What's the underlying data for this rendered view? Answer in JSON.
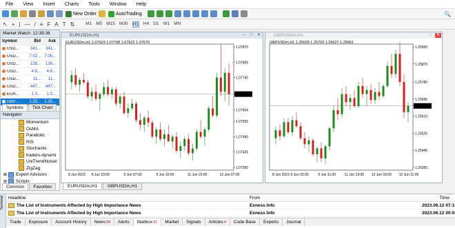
{
  "menu": [
    "File",
    "View",
    "Insert",
    "Charts",
    "Tools",
    "Window",
    "Help"
  ],
  "toolbar": {
    "new_order": "New Order",
    "autotrading": "AutoTrading"
  },
  "timeframes": [
    "M1",
    "M5",
    "M15",
    "M30",
    "H1",
    "H4",
    "D1",
    "W1",
    "MN"
  ],
  "market_watch": {
    "title": "Market Watch: 12:39:36",
    "headers": [
      "Symbol",
      "Bid",
      "Ask"
    ],
    "rows": [
      {
        "symbol": "USD...",
        "bid": "341...",
        "ask": "341...",
        "color": "#e07a2b"
      },
      {
        "symbol": "USD...",
        "bid": "7.02...",
        "ask": "7.05...",
        "color": "#e07a2b"
      },
      {
        "symbol": "USD...",
        "bid": "128...",
        "ask": "128...",
        "color": "#e07a2b"
      },
      {
        "symbol": "USD...",
        "bid": "4.6...",
        "ask": "4.6...",
        "color": "#e07a2b"
      },
      {
        "symbol": "USD...",
        "bid": "11...",
        "ask": "11...",
        "color": "#e07a2b"
      },
      {
        "symbol": "USD...",
        "bid": "447...",
        "ask": "447...",
        "color": "#e07a2b"
      },
      {
        "symbol": "EUR...",
        "bid": "1.0...",
        "ask": "1.0...",
        "color": "#e07a2b"
      },
      {
        "symbol": "GBP...",
        "bid": "1.25...",
        "ask": "1.25...",
        "color": "#ffffff"
      }
    ],
    "tabs": [
      "Symbols",
      "Tick Chart"
    ]
  },
  "navigator": {
    "title": "Navigator",
    "items": [
      "Momentum",
      "OsMA",
      "Parabolic",
      "RSI",
      "Stochastic",
      "traders-dynami",
      "UniTrendNoisel",
      "ZigZag"
    ],
    "groups": [
      "Expert Advisors",
      "Scripts"
    ],
    "tabs": [
      "Common",
      "Favorites"
    ]
  },
  "chart1": {
    "window_title": "EURUSDm,H1",
    "header": "EURUSDm,H1  1.07623 1.07708 1.07622 1.07670",
    "price_labels": [
      "1.07870",
      "1.07805",
      "1.07740",
      "1.07670",
      "1.07604",
      "1.07555",
      "1.07490",
      "1.07425",
      "1.07360"
    ],
    "current_price": "1.07670",
    "time_labels": [
      "8 Jun 2023",
      "8 Jun 23:00",
      "9 Jun 07:00",
      "9 Jun 15:00",
      "11 Jun 23:00",
      "12 Jun 07:00"
    ],
    "candles": [
      [
        1.0772,
        1.0777,
        1.0769,
        1.0775
      ],
      [
        1.0775,
        1.0778,
        1.077,
        1.0771
      ],
      [
        1.0771,
        1.0774,
        1.0768,
        1.0773
      ],
      [
        1.0773,
        1.0776,
        1.0771,
        1.0772
      ],
      [
        1.0772,
        1.0773,
        1.0765,
        1.0766
      ],
      [
        1.0766,
        1.077,
        1.0764,
        1.0768
      ],
      [
        1.0768,
        1.0771,
        1.0764,
        1.0765
      ],
      [
        1.0765,
        1.0768,
        1.076,
        1.0767
      ],
      [
        1.0767,
        1.0772,
        1.0766,
        1.077
      ],
      [
        1.077,
        1.0773,
        1.0766,
        1.0767
      ],
      [
        1.0767,
        1.077,
        1.0765,
        1.0769
      ],
      [
        1.0769,
        1.077,
        1.0762,
        1.0763
      ],
      [
        1.0763,
        1.0767,
        1.0761,
        1.0766
      ],
      [
        1.0766,
        1.0768,
        1.0758,
        1.0759
      ],
      [
        1.0759,
        1.0763,
        1.0757,
        1.0761
      ],
      [
        1.0761,
        1.0765,
        1.076,
        1.0763
      ],
      [
        1.0763,
        1.0764,
        1.0755,
        1.0756
      ],
      [
        1.0756,
        1.0759,
        1.0752,
        1.0754
      ],
      [
        1.0754,
        1.0758,
        1.0751,
        1.0757
      ],
      [
        1.0757,
        1.076,
        1.0753,
        1.0755
      ],
      [
        1.0755,
        1.0756,
        1.0748,
        1.0749
      ],
      [
        1.0749,
        1.0753,
        1.0746,
        1.0752
      ],
      [
        1.0752,
        1.0755,
        1.0747,
        1.0748
      ],
      [
        1.0748,
        1.0752,
        1.0745,
        1.075
      ],
      [
        1.075,
        1.0754,
        1.0747,
        1.0747
      ],
      [
        1.0747,
        1.075,
        1.0744,
        1.0749
      ],
      [
        1.0749,
        1.0751,
        1.0742,
        1.0743
      ],
      [
        1.0743,
        1.0747,
        1.074,
        1.0745
      ],
      [
        1.0745,
        1.0749,
        1.0743,
        1.0748
      ],
      [
        1.0748,
        1.075,
        1.0741,
        1.0742
      ],
      [
        1.0742,
        1.0746,
        1.0739,
        1.0744
      ],
      [
        1.0744,
        1.0752,
        1.0743,
        1.0751
      ],
      [
        1.0751,
        1.0756,
        1.0748,
        1.0749
      ],
      [
        1.0749,
        1.0753,
        1.0745,
        1.0752
      ],
      [
        1.0752,
        1.0762,
        1.0751,
        1.0761
      ],
      [
        1.0761,
        1.0766,
        1.0757,
        1.0758
      ],
      [
        1.0758,
        1.0776,
        1.0757,
        1.0774
      ],
      [
        1.0774,
        1.0788,
        1.0766,
        1.0768
      ],
      [
        1.0768,
        1.0778,
        1.0764,
        1.0776
      ],
      [
        1.0776,
        1.078,
        1.0762,
        1.0767
      ]
    ]
  },
  "chart2": {
    "window_title": "GBPUSDm,H1",
    "header": "GBPUSDm,H1  1.25628 1.25703 1.25627 1.25661",
    "price_labels": [
      "1.25955",
      "1.25870",
      "1.25780",
      "1.25695",
      "1.25661",
      "1.25610",
      "1.25525",
      "1.25440",
      "1.25355"
    ],
    "current_price": "1.25661",
    "time_labels": [
      "8 Jun 2023",
      "9 Jun 03:00",
      "9 Jun 11:00",
      "11 Jun 19:00",
      "12 Jun 03:00",
      "12 Jun 11:00"
    ],
    "candles": [
      [
        1.255,
        1.2556,
        1.2547,
        1.2554
      ],
      [
        1.2554,
        1.2557,
        1.2549,
        1.2551
      ],
      [
        1.2551,
        1.256,
        1.255,
        1.2558
      ],
      [
        1.2558,
        1.256,
        1.2552,
        1.2553
      ],
      [
        1.2553,
        1.2561,
        1.2551,
        1.2559
      ],
      [
        1.2559,
        1.2563,
        1.2555,
        1.2556
      ],
      [
        1.2556,
        1.2558,
        1.2549,
        1.255
      ],
      [
        1.255,
        1.2553,
        1.2545,
        1.2547
      ],
      [
        1.2547,
        1.2551,
        1.2543,
        1.2549
      ],
      [
        1.2549,
        1.255,
        1.2541,
        1.2542
      ],
      [
        1.2542,
        1.2546,
        1.2538,
        1.2545
      ],
      [
        1.2545,
        1.2548,
        1.2538,
        1.254
      ],
      [
        1.254,
        1.2547,
        1.2537,
        1.2546
      ],
      [
        1.2546,
        1.2556,
        1.2544,
        1.2555
      ],
      [
        1.2555,
        1.2566,
        1.2553,
        1.2564
      ],
      [
        1.2564,
        1.257,
        1.2559,
        1.2562
      ],
      [
        1.2562,
        1.2575,
        1.256,
        1.2572
      ],
      [
        1.2572,
        1.2576,
        1.2566,
        1.2568
      ],
      [
        1.2568,
        1.2572,
        1.2564,
        1.257
      ],
      [
        1.257,
        1.2574,
        1.2565,
        1.2566
      ],
      [
        1.2566,
        1.2578,
        1.2565,
        1.2576
      ],
      [
        1.2576,
        1.258,
        1.257,
        1.2572
      ],
      [
        1.2572,
        1.2576,
        1.2566,
        1.2574
      ],
      [
        1.2574,
        1.2577,
        1.2567,
        1.2569
      ],
      [
        1.2569,
        1.2575,
        1.2567,
        1.2573
      ],
      [
        1.2573,
        1.2578,
        1.2569,
        1.2571
      ],
      [
        1.2571,
        1.2577,
        1.257,
        1.2576
      ],
      [
        1.2576,
        1.2588,
        1.2575,
        1.2586
      ],
      [
        1.2586,
        1.2592,
        1.258,
        1.2582
      ],
      [
        1.2582,
        1.2594,
        1.258,
        1.2592
      ],
      [
        1.2592,
        1.2598,
        1.2576,
        1.2578
      ],
      [
        1.2578,
        1.2582,
        1.256,
        1.2563
      ],
      [
        1.2563,
        1.2568,
        1.2558,
        1.2566
      ]
    ]
  },
  "chart_tabs": [
    "EURUSDm,H1",
    "GBPUSDm,H1"
  ],
  "terminal": {
    "headers": [
      "Headline",
      "From",
      "Time"
    ],
    "rows": [
      {
        "headline": "The List of Instruments Affected by High Importance News",
        "from": "Exness Info",
        "time": "2023.06.12 07:18"
      },
      {
        "headline": "The List of Instruments Affected by High Importance News",
        "from": "Exness Info",
        "time": "2023.06.12 00:08"
      }
    ],
    "side_label": "Terminal",
    "tabs": [
      {
        "label": "Trade",
        "badge": ""
      },
      {
        "label": "Exposure",
        "badge": ""
      },
      {
        "label": "Account History",
        "badge": ""
      },
      {
        "label": "News",
        "badge": "99"
      },
      {
        "label": "Alerts",
        "badge": ""
      },
      {
        "label": "Mailbox",
        "badge": "21"
      },
      {
        "label": "Market",
        "badge": ""
      },
      {
        "label": "Signals",
        "badge": ""
      },
      {
        "label": "Articles",
        "badge": "4"
      },
      {
        "label": "Code Base",
        "badge": ""
      },
      {
        "label": "Experts",
        "badge": ""
      },
      {
        "label": "Journal",
        "badge": ""
      }
    ]
  },
  "colors": {
    "bull": "#1a8a1a",
    "bear": "#d91c1c",
    "accent": "#1679d2"
  }
}
